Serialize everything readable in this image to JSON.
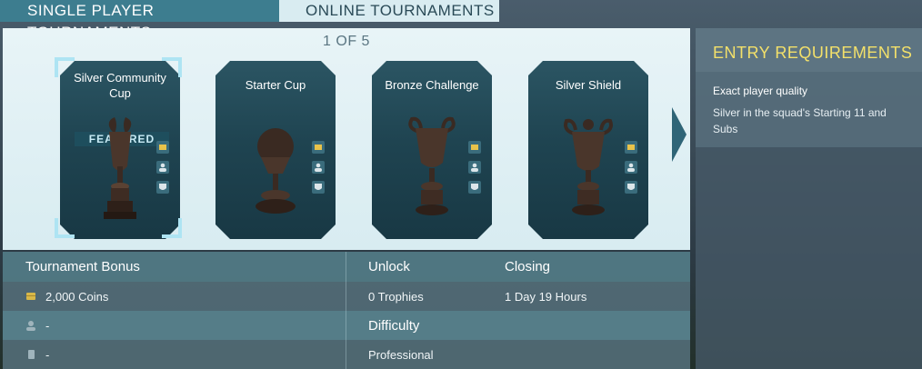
{
  "tabs": [
    {
      "label": "SINGLE PLAYER TOURNAMENTS",
      "active": true
    },
    {
      "label": "ONLINE TOURNAMENTS",
      "active": false
    }
  ],
  "pager": "1 OF 5",
  "cards": [
    {
      "name": "Silver Community Cup",
      "badge": "FEATURED",
      "selected": true
    },
    {
      "name": "Starter Cup"
    },
    {
      "name": "Bronze Challenge"
    },
    {
      "name": "Silver Shield"
    }
  ],
  "requirements": {
    "header": "ENTRY REQUIREMENTS",
    "title": "Exact player quality",
    "text": "Silver in the squad's Starting 11 and Subs"
  },
  "table": {
    "bonus_header": "Tournament Bonus",
    "coins": "2,000 Coins",
    "player_bonus": "-",
    "pack_bonus": "-",
    "unlock_header": "Unlock",
    "unlock_value": "0 Trophies",
    "closing_header": "Closing",
    "closing_value": "1 Day 19 Hours",
    "difficulty_header": "Difficulty",
    "difficulty_value": "Professional"
  },
  "colors": {
    "accent": "#3d7d8f",
    "requirements_header": "#f3e06a"
  }
}
